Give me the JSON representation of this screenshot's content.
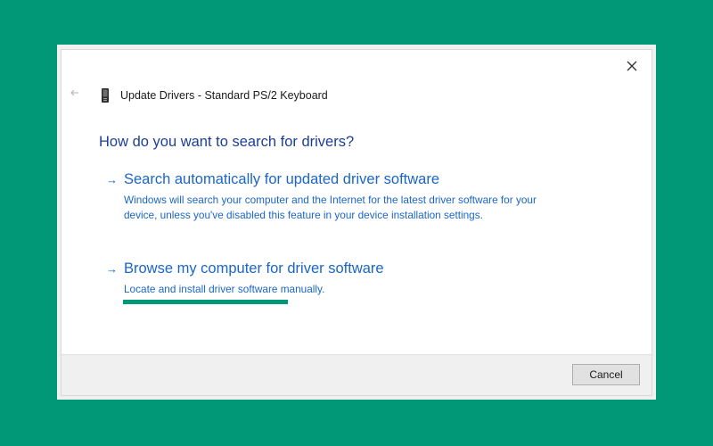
{
  "window": {
    "title": "Update Drivers - Standard PS/2 Keyboard",
    "close_icon": "close-icon",
    "back_icon": "back-arrow-icon",
    "device_icon": "keyboard-device-icon"
  },
  "main": {
    "heading": "How do you want to search for drivers?",
    "options": [
      {
        "title": "Search automatically for updated driver software",
        "description": "Windows will search your computer and the Internet for the latest driver software for your device, unless you've disabled this feature in your device installation settings."
      },
      {
        "title": "Browse my computer for driver software",
        "description": "Locate and install driver software manually."
      }
    ]
  },
  "footer": {
    "cancel_label": "Cancel"
  },
  "colors": {
    "background": "#019878",
    "heading": "#1c3f94",
    "link": "#1a66c8",
    "highlight": "#019878"
  }
}
